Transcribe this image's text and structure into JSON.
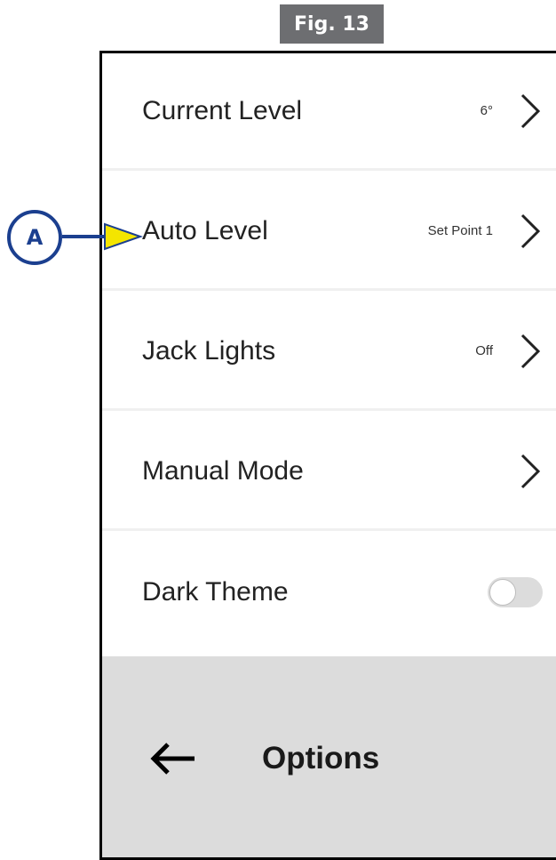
{
  "figure": {
    "label": "Fig. 13"
  },
  "callout": {
    "letter": "A"
  },
  "menu": {
    "items": [
      {
        "label": "Current Level",
        "value": "6°"
      },
      {
        "label": "Auto Level",
        "value": "Set Point 1"
      },
      {
        "label": "Jack Lights",
        "value": "Off"
      },
      {
        "label": "Manual Mode",
        "value": ""
      },
      {
        "label": "Dark Theme",
        "toggle_on": false
      }
    ]
  },
  "footer": {
    "title": "Options",
    "back_icon": "back-arrow-icon"
  },
  "colors": {
    "callout_blue": "#1b3f8f",
    "pointer_yellow": "#f4e500",
    "footer_gray": "#dcdcdc",
    "fig_label_gray": "#6d6e71"
  }
}
